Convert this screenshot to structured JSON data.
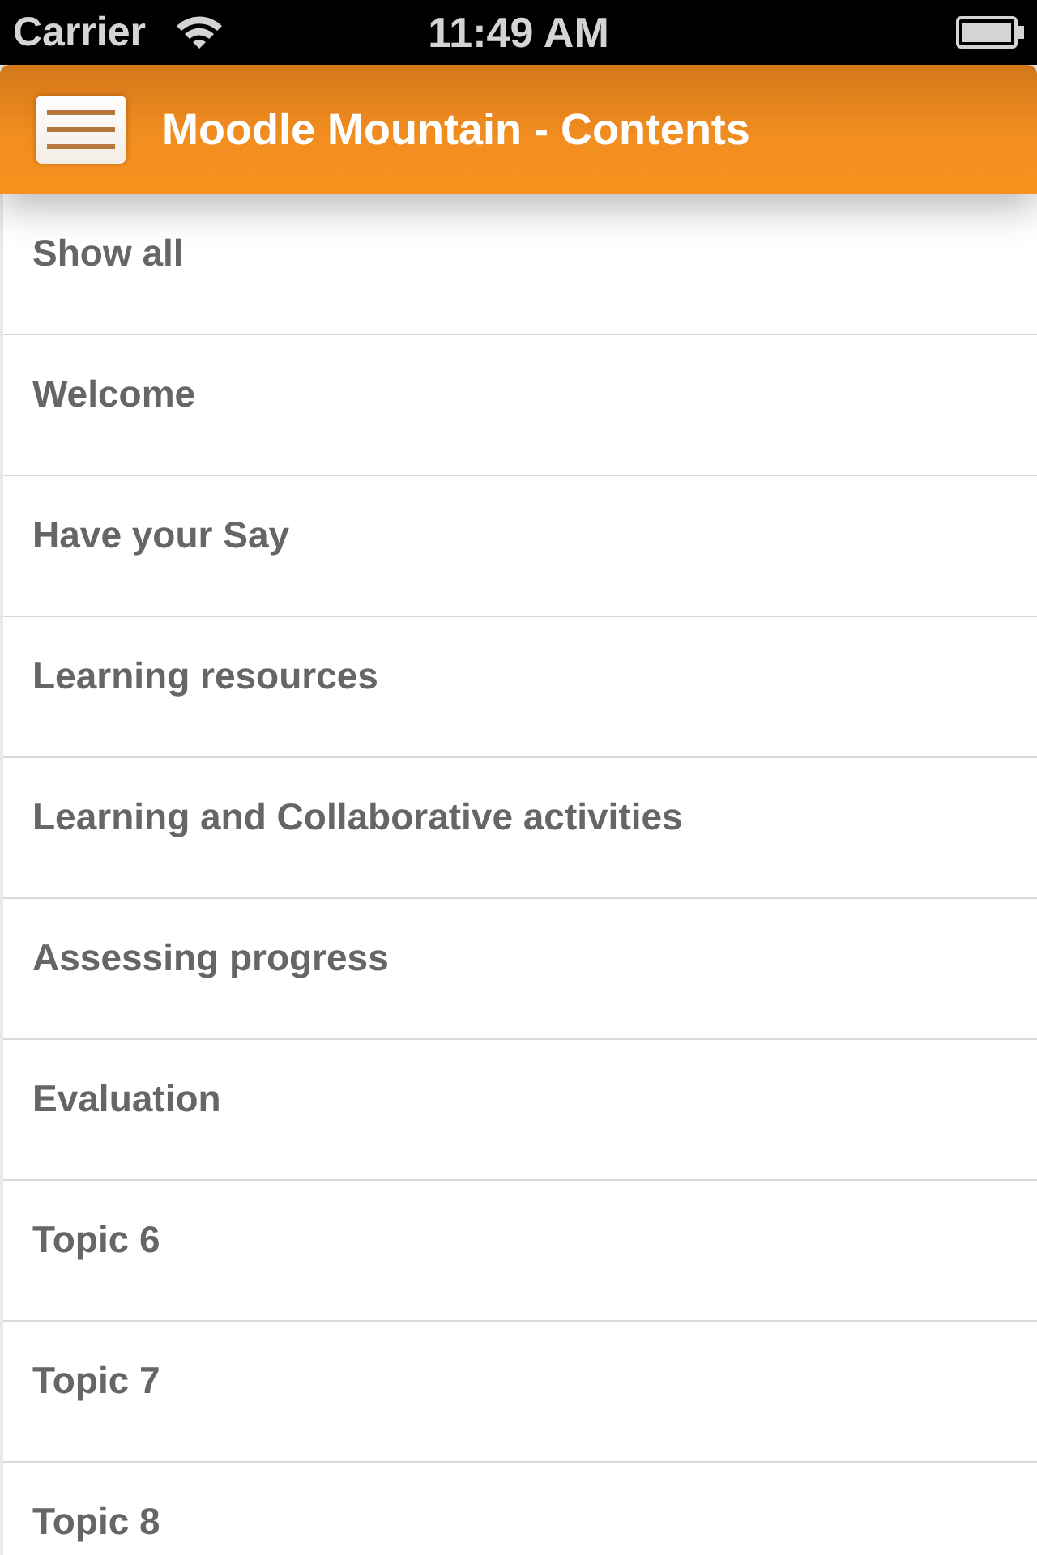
{
  "status_bar": {
    "carrier": "Carrier",
    "time": "11:49 AM"
  },
  "header": {
    "title": "Moodle Mountain - Contents"
  },
  "sections": [
    {
      "label": "Show all"
    },
    {
      "label": "Welcome"
    },
    {
      "label": "Have your Say"
    },
    {
      "label": "Learning resources"
    },
    {
      "label": "Learning and Collaborative activities"
    },
    {
      "label": "Assessing progress"
    },
    {
      "label": "Evaluation"
    },
    {
      "label": "Topic 6"
    },
    {
      "label": "Topic 7"
    },
    {
      "label": "Topic 8"
    }
  ]
}
